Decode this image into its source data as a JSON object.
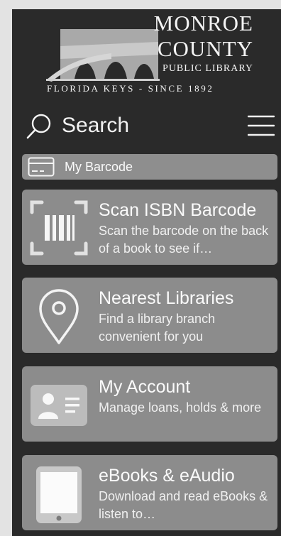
{
  "logo": {
    "line1": "MONROE",
    "line2": "COUNTY",
    "line3": "PUBLIC LIBRARY",
    "tagline": "FLORIDA KEYS - SINCE 1892"
  },
  "search": {
    "label": "Search",
    "icon": "search-icon"
  },
  "menu": {
    "icon": "hamburger-menu-icon"
  },
  "barcode": {
    "label": "My Barcode",
    "icon": "id-card-icon"
  },
  "cards": [
    {
      "title": "Scan ISBN Barcode",
      "description": "Scan the barcode on the back of a book to see if…",
      "icon": "barcode-scan-icon"
    },
    {
      "title": "Nearest Libraries",
      "description": "Find a library branch convenient for you",
      "icon": "location-pin-icon"
    },
    {
      "title": "My Account",
      "description": "Manage loans, holds & more",
      "icon": "account-card-icon"
    },
    {
      "title": "eBooks & eAudio",
      "description": "Download and read eBooks & listen to…",
      "icon": "tablet-icon"
    }
  ],
  "colors": {
    "page_background": "#e3e3e3",
    "app_background": "#2a2a2a",
    "tile": "#8c8c8c",
    "text": "#fafafa"
  }
}
